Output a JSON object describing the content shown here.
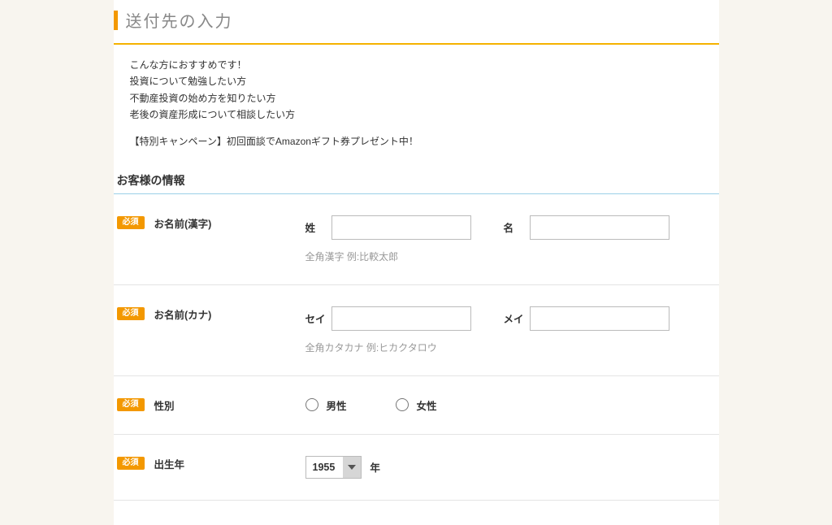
{
  "section_title": "送付先の入力",
  "intro": {
    "line1": "こんな方におすすめです！",
    "line2": "投資について勉強したい方",
    "line3": "不動産投資の始め方を知りたい方",
    "line4": "老後の資産形成について相談したい方",
    "promo": "【特別キャンペーン】初回面談でAmazonギフト券プレゼント中！"
  },
  "subhead": "お客様の情報",
  "required_badge": "必須",
  "fields": {
    "name_kanji": {
      "label": "お名前(漢字)",
      "sei_label": "姓",
      "mei_label": "名",
      "hint": "全角漢字 例:比較太郎"
    },
    "name_kana": {
      "label": "お名前(カナ)",
      "sei_label": "セイ",
      "mei_label": "メイ",
      "hint": "全角カタカナ 例:ヒカクタロウ"
    },
    "gender": {
      "label": "性別",
      "male": "男性",
      "female": "女性"
    },
    "birth_year": {
      "label": "出生年",
      "value": "1955",
      "suffix": "年"
    }
  }
}
